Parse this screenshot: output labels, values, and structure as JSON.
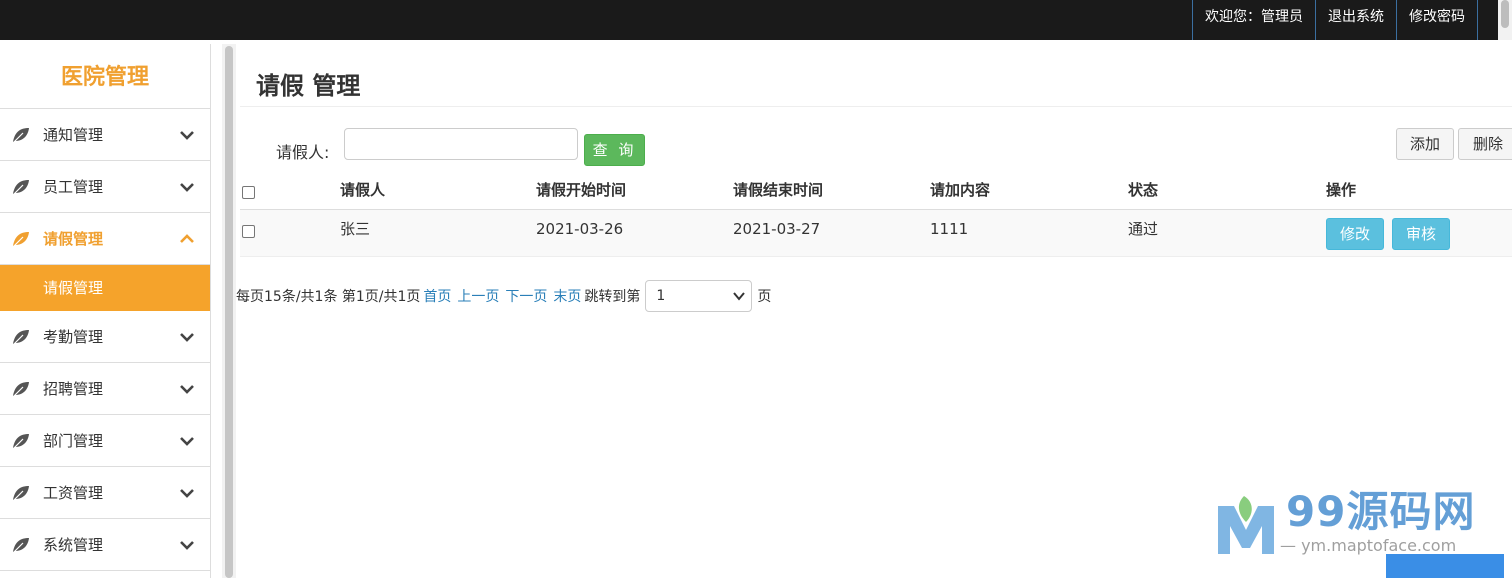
{
  "topbar": {
    "welcome": "欢迎您：管理员",
    "logout": "退出系统",
    "change_password": "修改密码"
  },
  "sidebar": {
    "brand": "医院管理",
    "items": [
      {
        "label": "通知管理",
        "icon": "leaf-icon",
        "active": false
      },
      {
        "label": "员工管理",
        "icon": "leaf-icon",
        "active": false
      },
      {
        "label": "请假管理",
        "icon": "leaf-icon",
        "active": true
      },
      {
        "label": "考勤管理",
        "icon": "leaf-icon",
        "active": false
      },
      {
        "label": "招聘管理",
        "icon": "leaf-icon",
        "active": false
      },
      {
        "label": "部门管理",
        "icon": "leaf-icon",
        "active": false
      },
      {
        "label": "工资管理",
        "icon": "leaf-icon",
        "active": false
      },
      {
        "label": "系统管理",
        "icon": "leaf-icon",
        "active": false
      }
    ],
    "submenu_label": "请假管理",
    "accent_color": "#f5a32b"
  },
  "main": {
    "title": "请假 管理",
    "search": {
      "label": "请假人:",
      "value": "",
      "query_button": "查 询"
    },
    "add_button": "添加",
    "delete_button": "删除",
    "table": {
      "headers": [
        "请假人",
        "请假开始时间",
        "请假结束时间",
        "请加内容",
        "状态",
        "操作"
      ],
      "rows": [
        {
          "name": "张三",
          "start": "2021-03-26",
          "end": "2021-03-27",
          "content": "1111",
          "status": "通过",
          "edit": "修改",
          "audit": "审核"
        }
      ]
    },
    "pager": {
      "summary": "每页15条/共1条 第1页/共1页",
      "first": "首页",
      "prev": "上一页",
      "next": "下一页",
      "last": "末页",
      "jump_label": "跳转到第",
      "page_value": "1",
      "page_suffix": "页"
    }
  },
  "watermark": {
    "logo_letter": "M",
    "text": "99源码网",
    "url": "— ym.maptoface.com"
  }
}
